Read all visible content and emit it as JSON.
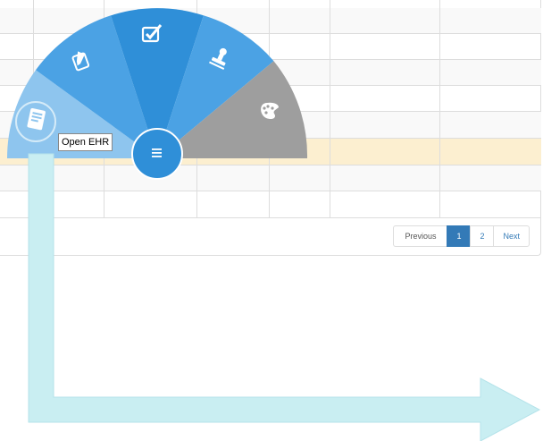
{
  "table": {
    "row_count": 8,
    "highlighted_row": 5
  },
  "pagination": {
    "previous": "Previous",
    "pages": [
      "1",
      "2"
    ],
    "active_page": "1",
    "next": "Next"
  },
  "radial_menu": {
    "center_glyph": "≡",
    "items": [
      {
        "name": "open-ehr",
        "icon": "ehr-document-icon",
        "color": "#8ec5ee",
        "state": "hover"
      },
      {
        "name": "edit",
        "icon": "pencil-icon",
        "color": "#4ba2e4"
      },
      {
        "name": "check",
        "icon": "checkbox-icon",
        "color": "#2f8fd8"
      },
      {
        "name": "stamp",
        "icon": "stamp-icon",
        "color": "#4ba2e4"
      },
      {
        "name": "palette",
        "icon": "palette-icon",
        "color": "#9e9e9e"
      }
    ]
  },
  "tooltip": {
    "text": "Open EHR"
  },
  "colors": {
    "highlight_row": "#fcefd0",
    "menu_center": "#2f8fd8",
    "arrow": "#c9eef2",
    "pagination_active": "#337ab7"
  }
}
